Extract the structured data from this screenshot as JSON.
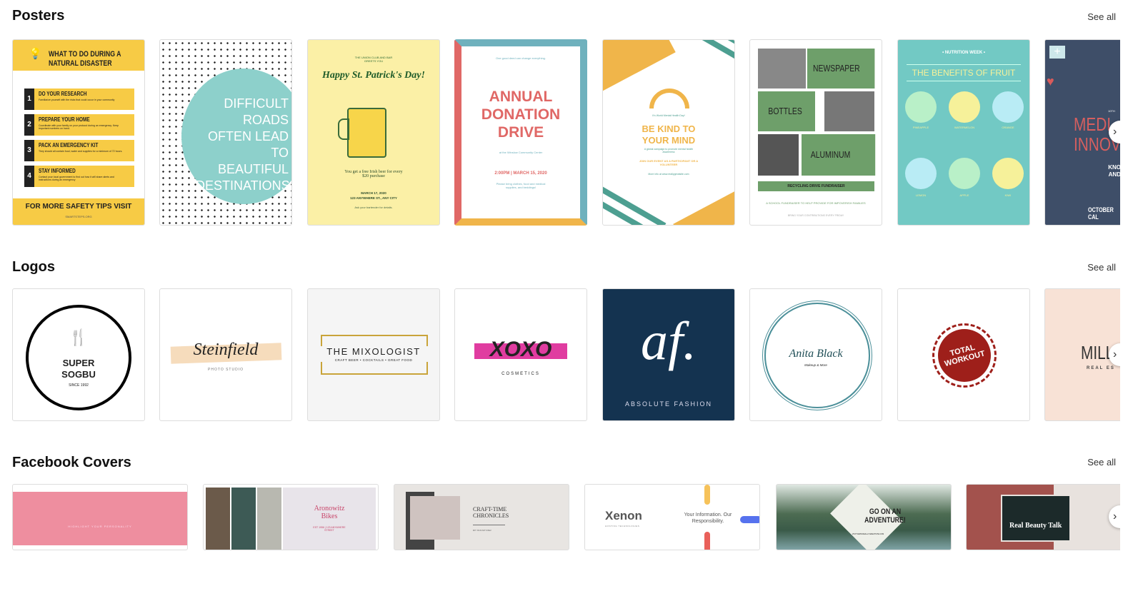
{
  "sections": {
    "posters": {
      "title": "Posters",
      "see_all": "See all"
    },
    "logos": {
      "title": "Logos",
      "see_all": "See all"
    },
    "covers": {
      "title": "Facebook Covers",
      "see_all": "See all"
    }
  },
  "next_icon": "chevron-right-icon",
  "next_glyph": "›",
  "posters": [
    {
      "title": "WHAT TO DO DURING A NATURAL DISASTER",
      "steps": [
        {
          "n": "1",
          "head": "DO YOUR RESEARCH",
          "body": "Familiarize yourself with the risks that could occur in your community"
        },
        {
          "n": "2",
          "head": "PREPARE YOUR HOME",
          "body": "Coordinate with your family on your protocol during an emergency. Keep important numbers on hand."
        },
        {
          "n": "3",
          "head": "PACK AN EMERGENCY KIT",
          "body": "They should all contain food, water and supplies for a minimum of 72 hours."
        },
        {
          "n": "4",
          "head": "STAY INFORMED",
          "body": "Contact your local government to find out how it will share alerts and instructions during an emergency"
        }
      ],
      "footer": "FOR MORE SAFETY TIPS VISIT",
      "site": "SMARTSTEPS.ORG",
      "color": "#f7cb45"
    },
    {
      "lines": [
        "DIFFICULT ROADS",
        "OFTEN LEAD TO",
        "BEAUTIFUL",
        "DESTINATIONS"
      ],
      "color": "#8dd0cb"
    },
    {
      "kicker": "THE UNION CLUB AND BAR GREETS YOU",
      "title": "Happy St. Patrick's Day!",
      "offer": "You get a free Irish beer for every $20 purchase",
      "date": "MARCH 17, 2020",
      "address": "123 ANYWHERE ST., ANY CITY",
      "note": "Ask your bartender for details.",
      "color": "#fbf0a6"
    },
    {
      "kicker": "One good deed can change everything.",
      "title": "ANNUAL DONATION DRIVE",
      "venue": "at the Winslow Community Center",
      "when": "2:00PM | MARCH 15, 2020",
      "note": "Please bring clothes, food and medical supplies, and beddings!",
      "color": "#e06866"
    },
    {
      "kicker": "It's World Mental Health Day!",
      "title": "BE KIND TO YOUR MIND",
      "sub": "A global campaign to promote mental health awareness",
      "cta": "JOIN OUR EVENT AS A PARTICIPANT OR A VOLUNTEER",
      "info": "More info at www.reallygreatsite.com",
      "color": "#f0b54a"
    },
    {
      "words": [
        "NEWSPAPER",
        "BOTTLES",
        "ALUMINUM"
      ],
      "banner": "RECYCLING DRIVE FUNDRAISER",
      "sub": "A SCHOOL FUNDRAISER TO HELP PROVIDE FOR IMPOVERISH FAMILIES",
      "note": "BRING YOUR CONTRIBUTIONS EVERY FRIDAY",
      "color": "#6e9f6a"
    },
    {
      "kicker": "• NUTRITION WEEK •",
      "title": "THE BENEFITS OF FRUIT",
      "fruits": [
        "PINEAPPLE",
        "WATERMELON",
        "ORANGE",
        "LEMON",
        "APPLE",
        "KIWI"
      ],
      "color": "#72c9c4"
    },
    {
      "kicker": "10TH",
      "title": "MEDI INNOV",
      "sub": "KNO AND",
      "date": "OCTOBER CAL",
      "color": "#3e4e68"
    }
  ],
  "logos": [
    {
      "name": "SUPER SOGBU",
      "sub": "SINCE 1992"
    },
    {
      "name": "Steinfield",
      "sub": "PHOTO STUDIO"
    },
    {
      "name": "THE MIXOLOGIST",
      "sub": "CRAFT BEER • COCKTAILS • GREAT FOOD"
    },
    {
      "name": "XOXO",
      "sub": "COSMETICS"
    },
    {
      "name": "af.",
      "sub": "ABSOLUTE FASHION"
    },
    {
      "name": "Anita Black",
      "sub": "Makeup & More"
    },
    {
      "name": "TOTAL WORKOUT"
    },
    {
      "name": "MILL",
      "sub": "REAL ES"
    }
  ],
  "covers": [
    {
      "text": "HIGHLIGHT YOUR PERSONALITY"
    },
    {
      "name": "Aronowitz Bikes",
      "sub": "EST 1956 | 123 ANYWHERE STREET"
    },
    {
      "name": "CRAFT-TIME CHRONICLES",
      "sub": "DIY IS IN MY DNA!"
    },
    {
      "name": "Xenon",
      "sub": "HOSTING TECHNOLOGIES",
      "tag": "Your Information. Our Responsibility."
    },
    {
      "name": "GO ON AN ADVENTURE!",
      "sub": "VISIT WWW.REALLYGREATSITE.COM"
    },
    {
      "name": "Real Beauty Talk"
    }
  ]
}
